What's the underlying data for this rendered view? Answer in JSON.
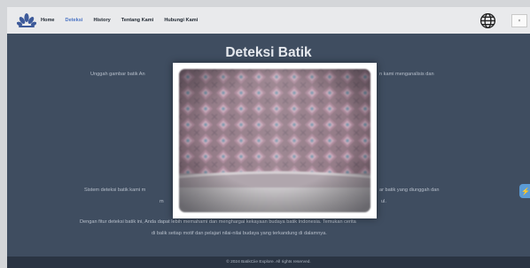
{
  "nav": {
    "items": [
      {
        "label": "Home",
        "active": false
      },
      {
        "label": "Deteksi",
        "active": true
      },
      {
        "label": "History",
        "active": false
      },
      {
        "label": "Tentang Kami",
        "active": false
      },
      {
        "label": "Hubungi Kami",
        "active": false
      }
    ],
    "lang_close": "×",
    "globe_icon": "globe-icon",
    "logo_icon": "batik-flower-logo"
  },
  "main": {
    "title": "Deteksi Batik",
    "intro_left": "Unggah gambar batik An",
    "intro_right": "n kami menganalisis dan",
    "p2_a_left": "Sistem deteksi batik kami m",
    "p2_a_right": "ar batik yang diunggah dan",
    "p2_b_left": "m",
    "p2_b_right": "ul.",
    "p3_a": "Dengan fitur deteksi batik ini, Anda dapat lebih memahami dan menghargai kekayaan budaya batik Indonesia. Temukan cerita",
    "p3_b": "di balik setiap motif dan pelajari nilai-nilai budaya yang terkandung di dalamnya."
  },
  "modal": {
    "image_subject": "camera-preview-of-batik-cloth"
  },
  "side_button": {
    "icon": "lightning-icon"
  },
  "footer": {
    "text": "© 2024 BatikCiie Explore. All rights reserved."
  },
  "colors": {
    "nav_bg": "#e9eaec",
    "page_bg": "#3f4d60",
    "active_link": "#4b74c4",
    "footer_bg": "#2a3443",
    "side_button": "#5b9bd5"
  }
}
